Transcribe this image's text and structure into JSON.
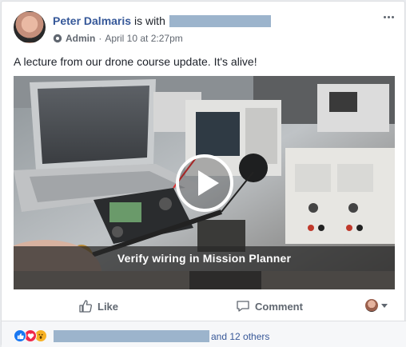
{
  "header": {
    "author_name": "Peter Dalmaris",
    "with_text": "is with",
    "role": "Admin",
    "timestamp": "April 10 at 2:27pm"
  },
  "post": {
    "text": "A lecture from our drone course update. It's alive!"
  },
  "video": {
    "caption": "Verify wiring in Mission Planner"
  },
  "actions": {
    "like_label": "Like",
    "comment_label": "Comment"
  },
  "reactions": {
    "others_text": "and 12 others",
    "icons": [
      "like-reaction-icon",
      "love-reaction-icon",
      "wow-reaction-icon"
    ]
  },
  "colors": {
    "link_blue": "#365899",
    "secondary_text": "#606770",
    "like_blue": "#1877f2",
    "love_red": "#f0284a",
    "wow_yellow": "#f7b125"
  }
}
